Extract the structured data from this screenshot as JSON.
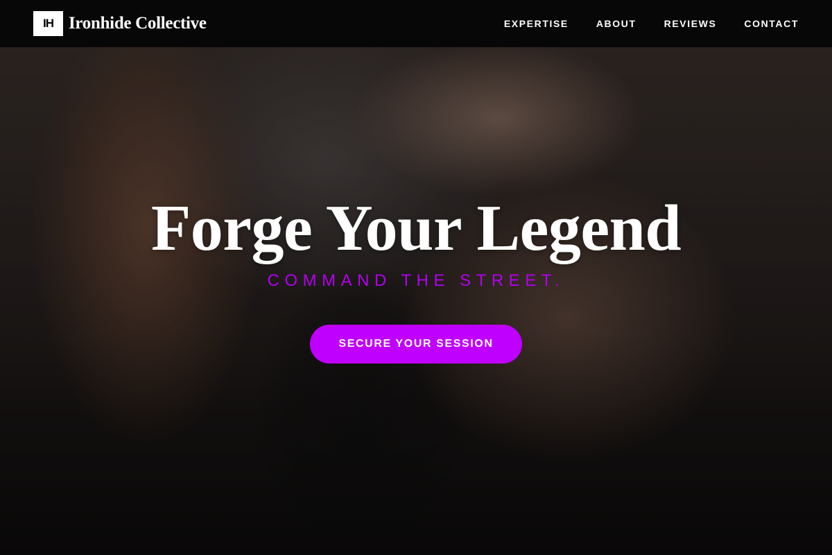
{
  "header": {
    "logo_mark": "IH",
    "brand_name": "Ironhide Collective",
    "nav": [
      {
        "label": "EXPERTISE"
      },
      {
        "label": "ABOUT"
      },
      {
        "label": "REVIEWS"
      },
      {
        "label": "CONTACT"
      }
    ]
  },
  "hero": {
    "title": "Forge Your Legend",
    "subtitle": "COMMAND THE STREET.",
    "cta_label": "SECURE YOUR SESSION",
    "background_image": "tattoo-artist-working-photo"
  },
  "colors": {
    "accent": "#c000ff",
    "header_bg": "#050505",
    "text": "#ffffff"
  }
}
